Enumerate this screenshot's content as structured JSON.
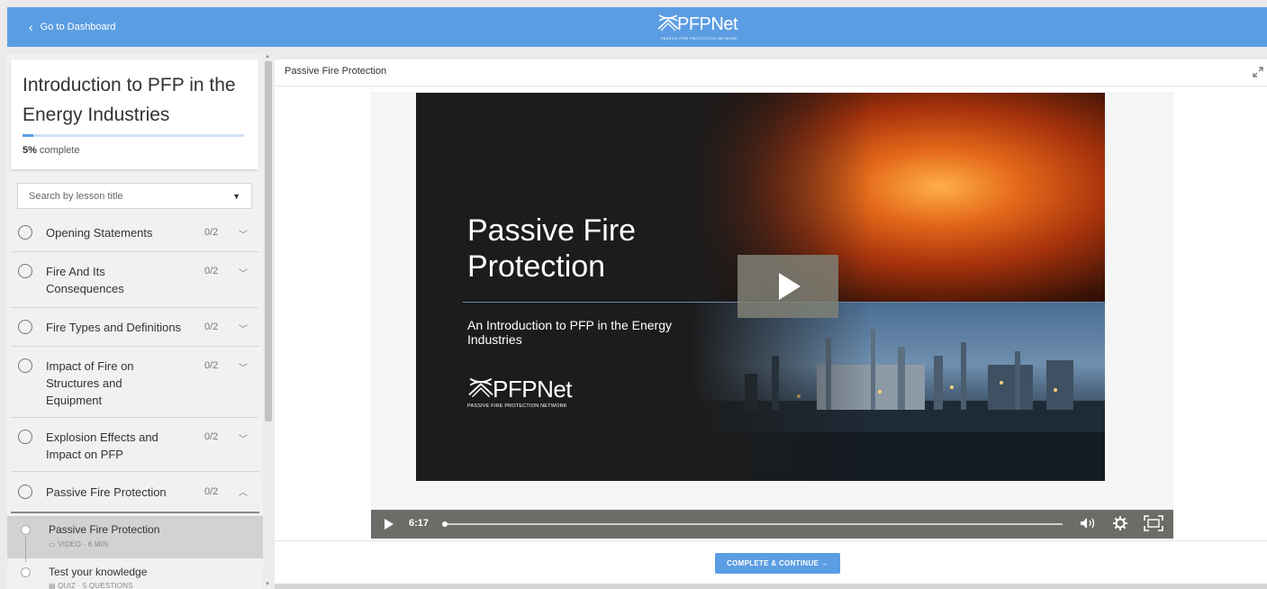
{
  "topbar": {
    "back_label": "Go to Dashboard",
    "brand_name": "PFPNet",
    "brand_tagline": "PASSIVE FIRE PROTECTION NETWORK"
  },
  "course": {
    "title": "Introduction to PFP in the Energy Industries",
    "progress_percent": 5,
    "progress_value": "5%",
    "progress_suffix": " complete"
  },
  "search": {
    "placeholder": "Search by lesson title"
  },
  "chapters": [
    {
      "title": "Opening Statements",
      "count": "0/2",
      "expanded": false
    },
    {
      "title": "Fire And Its Consequences",
      "count": "0/2",
      "expanded": false
    },
    {
      "title": "Fire Types and Definitions",
      "count": "0/2",
      "expanded": false
    },
    {
      "title": "Impact of Fire on Structures and Equipment",
      "count": "0/2",
      "expanded": false
    },
    {
      "title": "Explosion Effects and Impact on PFP",
      "count": "0/2",
      "expanded": false
    },
    {
      "title": "Passive Fire Protection",
      "count": "0/2",
      "expanded": true
    }
  ],
  "lessons": [
    {
      "title": "Passive Fire Protection",
      "meta": "VIDEO · 6 MIN",
      "active": true
    },
    {
      "title": "Test your knowledge",
      "meta": "QUIZ · 5 QUESTIONS",
      "active": false
    }
  ],
  "main": {
    "heading": "Passive Fire Protection",
    "slide_title": "Passive Fire Protection",
    "slide_subtitle": "An Introduction to PFP in the Energy Industries",
    "slide_brand_name": "PFPNet",
    "slide_brand_tagline": "PASSIVE FIRE PROTECTION NETWORK",
    "video_time": "6:17",
    "complete_button": "COMPLETE & CONTINUE →"
  },
  "colors": {
    "accent": "#5b9de3",
    "player_bar": "#6b6e68"
  }
}
